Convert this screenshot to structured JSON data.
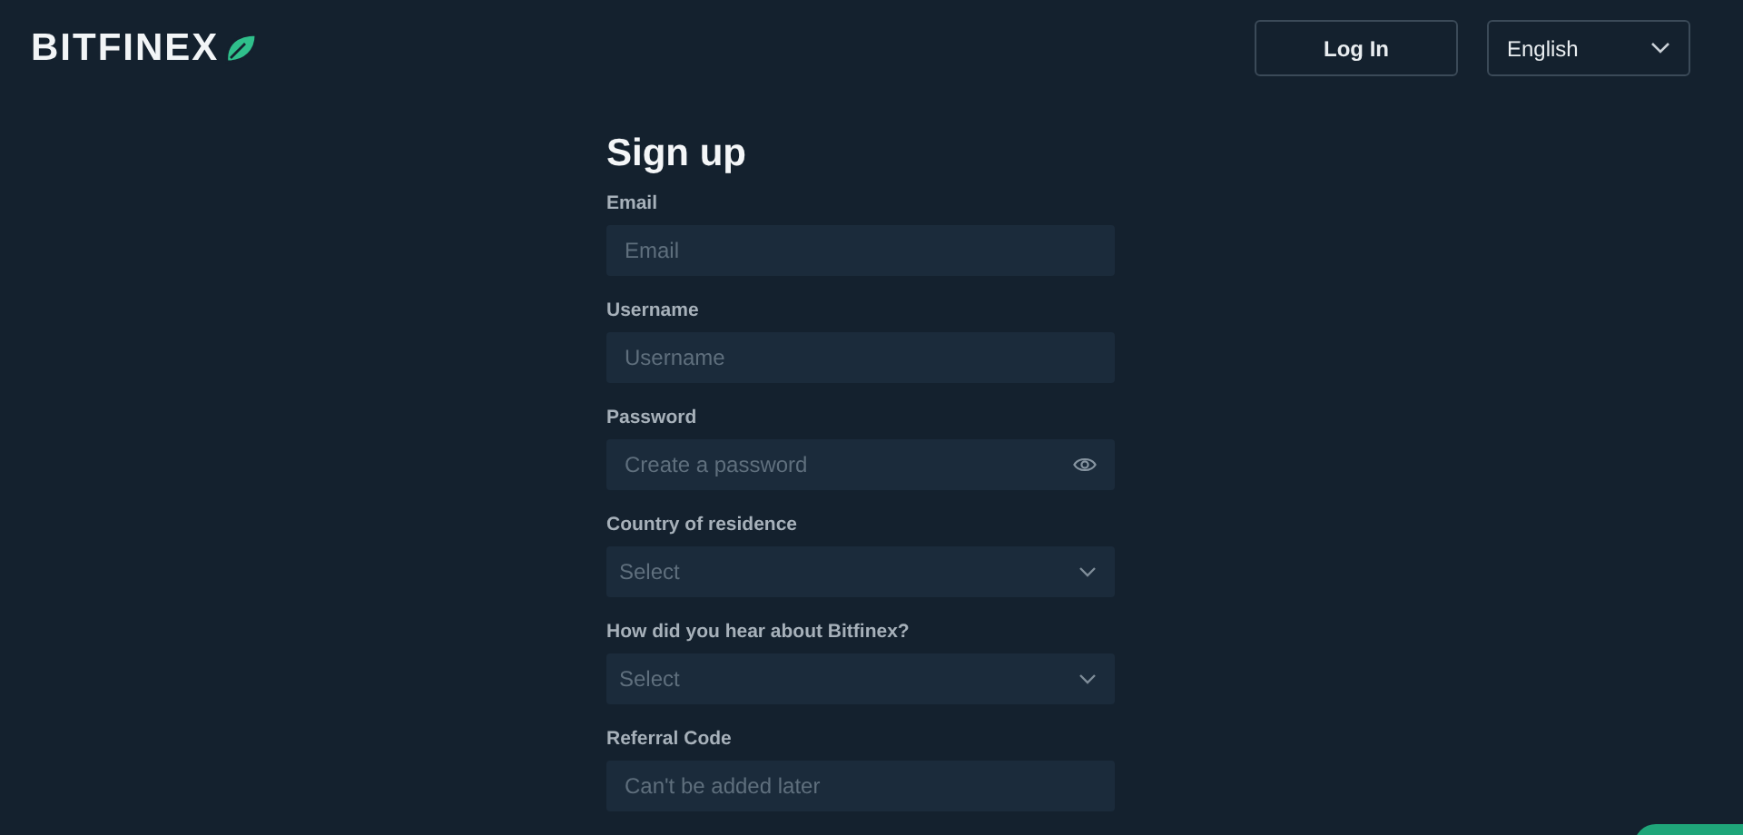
{
  "header": {
    "brand": "BITFINEX",
    "login_button": "Log In",
    "language": {
      "value": "English"
    }
  },
  "form": {
    "title": "Sign up",
    "fields": [
      {
        "label": "Email",
        "kind": "text",
        "placeholder": "Email"
      },
      {
        "label": "Username",
        "kind": "text",
        "placeholder": "Username"
      },
      {
        "label": "Password",
        "kind": "password",
        "placeholder": "Create a password"
      },
      {
        "label": "Country of residence",
        "kind": "select",
        "placeholder": "Select"
      },
      {
        "label": "How did you hear about Bitfinex?",
        "kind": "select",
        "placeholder": "Select"
      },
      {
        "label": "Referral Code",
        "kind": "text",
        "placeholder": "Can't be added later"
      }
    ]
  }
}
